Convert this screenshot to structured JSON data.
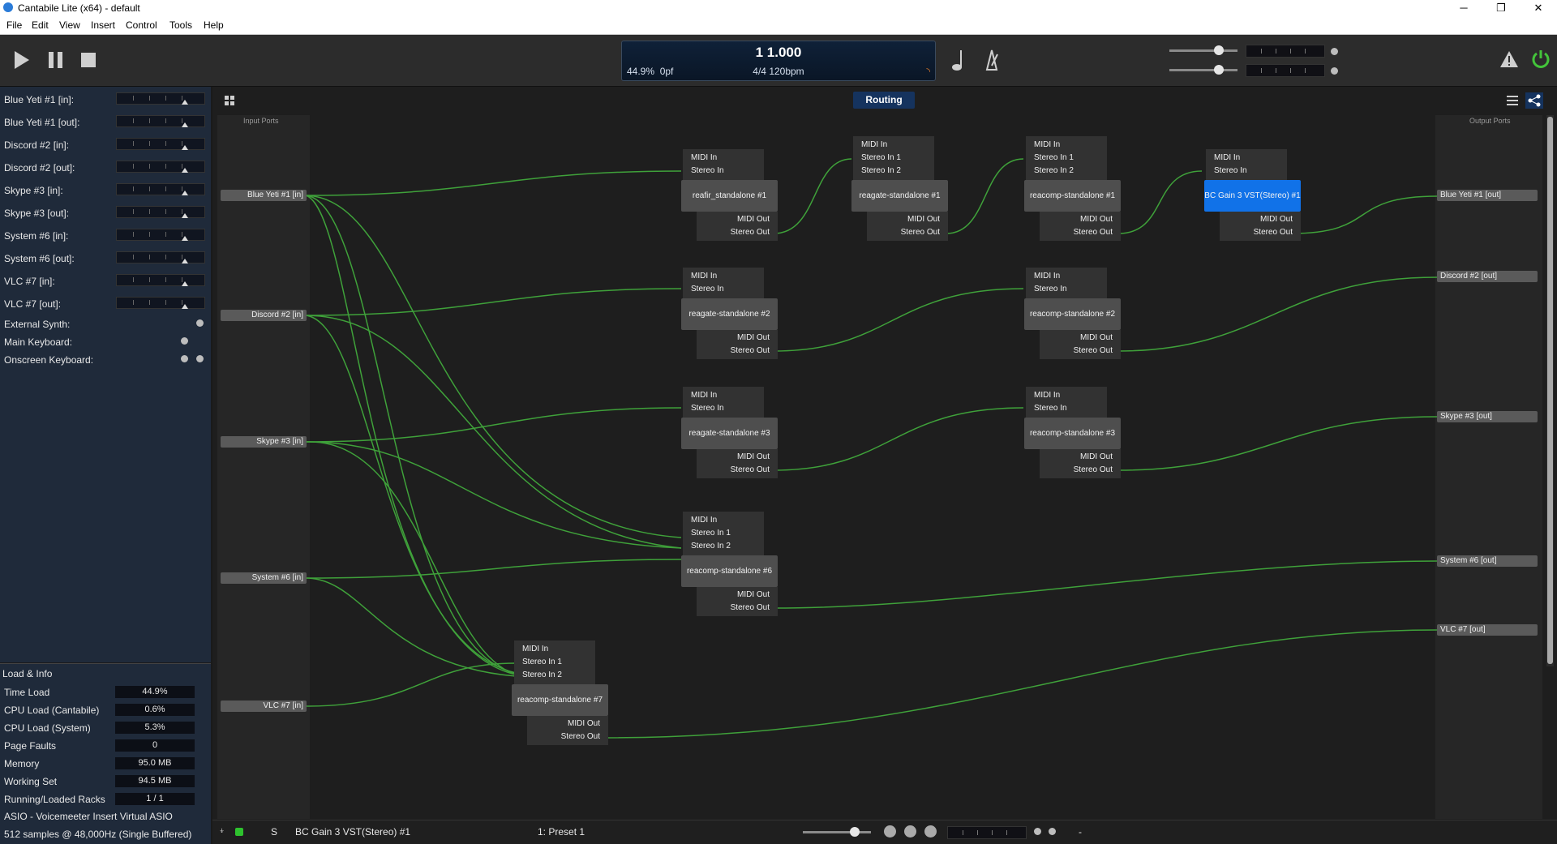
{
  "window": {
    "title": "Cantabile Lite (x64) - default",
    "minimize": "─",
    "maximize": "❐",
    "close": "✕"
  },
  "menu": [
    "File",
    "Edit",
    "View",
    "Insert",
    "Control",
    "Tools",
    "Help"
  ],
  "transport": {
    "play_icon": "play-icon",
    "pause_icon": "pause-icon",
    "stop_icon": "stop-icon",
    "position": "1 1.000",
    "time_signature": "4/4 120bpm",
    "load": "44.9%",
    "pf": "0pf"
  },
  "sidebar": {
    "ports": [
      {
        "label": "Blue Yeti #1 [in]:"
      },
      {
        "label": "Blue Yeti #1 [out]:"
      },
      {
        "label": "Discord #2 [in]:"
      },
      {
        "label": "Discord #2 [out]:"
      },
      {
        "label": "Skype #3 [in]:"
      },
      {
        "label": "Skype #3 [out]:"
      },
      {
        "label": "System #6 [in]:"
      },
      {
        "label": "System #6 [out]:"
      },
      {
        "label": "VLC #7 [in]:"
      },
      {
        "label": "VLC #7 [out]:"
      }
    ],
    "midi_ports": [
      {
        "label": "External Synth:"
      },
      {
        "label": "Main Keyboard:"
      },
      {
        "label": "Onscreen Keyboard:"
      }
    ]
  },
  "load_info": {
    "heading": "Load & Info",
    "rows": [
      {
        "label": "Time Load",
        "value": "44.9%"
      },
      {
        "label": "CPU Load (Cantabile)",
        "value": "0.6%"
      },
      {
        "label": "CPU Load (System)",
        "value": "5.3%"
      },
      {
        "label": "Page Faults",
        "value": "0"
      },
      {
        "label": "Memory",
        "value": "95.0 MB"
      },
      {
        "label": "Working Set",
        "value": "94.5 MB"
      },
      {
        "label": "Running/Loaded Racks",
        "value": "1 / 1"
      }
    ],
    "driver": "ASIO - Voicemeeter Insert Virtual ASIO",
    "buffer": "512 samples @ 48,000Hz (Single Buffered)"
  },
  "routing": {
    "tab_label": "Routing",
    "input_ports_label": "Input Ports",
    "output_ports_label": "Output Ports",
    "inputs": [
      "Blue Yeti #1 [in]",
      "Discord #2 [in]",
      "Skype #3 [in]",
      "System #6 [in]",
      "VLC #7 [in]"
    ],
    "outputs": [
      "Blue Yeti #1 [out]",
      "Discord #2 [out]",
      "Skype #3 [out]",
      "System #6 [out]",
      "VLC #7 [out]"
    ],
    "nodes": [
      {
        "name": "reafir_standalone #1",
        "inputs": [
          "MIDI In",
          "Stereo In"
        ],
        "outputs": [
          "MIDI Out",
          "Stereo Out"
        ]
      },
      {
        "name": "reagate-standalone #1",
        "inputs": [
          "MIDI In",
          "Stereo In 1",
          "Stereo In 2"
        ],
        "outputs": [
          "MIDI Out",
          "Stereo Out"
        ]
      },
      {
        "name": "reacomp-standalone #1",
        "inputs": [
          "MIDI In",
          "Stereo In 1",
          "Stereo In 2"
        ],
        "outputs": [
          "MIDI Out",
          "Stereo Out"
        ]
      },
      {
        "name": "BC Gain 3 VST(Stereo) #1",
        "inputs": [
          "MIDI In",
          "Stereo In"
        ],
        "outputs": [
          "MIDI Out",
          "Stereo Out"
        ]
      },
      {
        "name": "reagate-standalone #2",
        "inputs": [
          "MIDI In",
          "Stereo In"
        ],
        "outputs": [
          "MIDI Out",
          "Stereo Out"
        ]
      },
      {
        "name": "reacomp-standalone #2",
        "inputs": [
          "MIDI In",
          "Stereo In"
        ],
        "outputs": [
          "MIDI Out",
          "Stereo Out"
        ]
      },
      {
        "name": "reagate-standalone #3",
        "inputs": [
          "MIDI In",
          "Stereo In"
        ],
        "outputs": [
          "MIDI Out",
          "Stereo Out"
        ]
      },
      {
        "name": "reacomp-standalone #3",
        "inputs": [
          "MIDI In",
          "Stereo In"
        ],
        "outputs": [
          "MIDI Out",
          "Stereo Out"
        ]
      },
      {
        "name": "reacomp-standalone #6",
        "inputs": [
          "MIDI In",
          "Stereo In 1",
          "Stereo In 2"
        ],
        "outputs": [
          "MIDI Out",
          "Stereo Out"
        ]
      },
      {
        "name": "reacomp-standalone #7",
        "inputs": [
          "MIDI In",
          "Stereo In 1",
          "Stereo In 2"
        ],
        "outputs": [
          "MIDI Out",
          "Stereo Out"
        ]
      }
    ]
  },
  "statusbar": {
    "plugin": "BC Gain 3 VST(Stereo) #1",
    "preset": "1: Preset 1",
    "s_label": "S",
    "dash": "-"
  },
  "colors": {
    "accent": "#1172e8",
    "wire": "#3fa13a",
    "power": "#43c43a"
  }
}
